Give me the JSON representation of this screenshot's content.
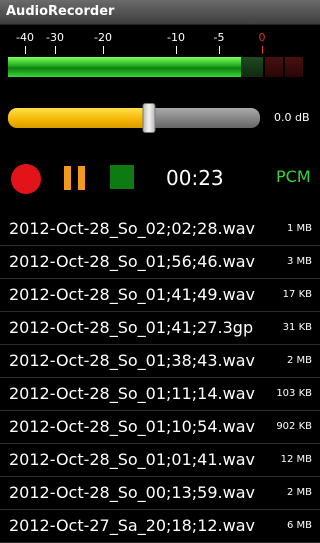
{
  "app": {
    "title": "AudioRecorder"
  },
  "meter": {
    "scale_labels": [
      {
        "text": "-40",
        "db": -40
      },
      {
        "text": "-30",
        "db": -30
      },
      {
        "text": "-20",
        "db": -20
      },
      {
        "text": "-10",
        "db": -10
      },
      {
        "text": "-5",
        "db": -5
      },
      {
        "text": "0",
        "db": 0
      }
    ],
    "colors": {
      "level": "#1ea81e",
      "clip": "#e03030"
    }
  },
  "gain": {
    "level_fraction": 0.56,
    "label": "0.0 dB"
  },
  "controls": {
    "record_icon": "record-icon",
    "pause_icon": "pause-icon",
    "stop_icon": "stop-icon",
    "timer": "00:23",
    "format": "PCM"
  },
  "files": [
    {
      "name": "2012-Oct-28_So_02;02;28.wav",
      "size": "1 MB"
    },
    {
      "name": "2012-Oct-28_So_01;56;46.wav",
      "size": "3 MB"
    },
    {
      "name": "2012-Oct-28_So_01;41;49.wav",
      "size": "17 KB"
    },
    {
      "name": "2012-Oct-28_So_01;41;27.3gp",
      "size": "31 KB"
    },
    {
      "name": "2012-Oct-28_So_01;38;43.wav",
      "size": "2 MB"
    },
    {
      "name": "2012-Oct-28_So_01;11;14.wav",
      "size": "103 KB"
    },
    {
      "name": "2012-Oct-28_So_01;10;54.wav",
      "size": "902 KB"
    },
    {
      "name": "2012-Oct-28_So_01;01;41.wav",
      "size": "12 MB"
    },
    {
      "name": "2012-Oct-28_So_00;13;59.wav",
      "size": "2 MB"
    },
    {
      "name": "2012-Oct-27_Sa_20;18;12.wav",
      "size": "6 MB"
    }
  ]
}
